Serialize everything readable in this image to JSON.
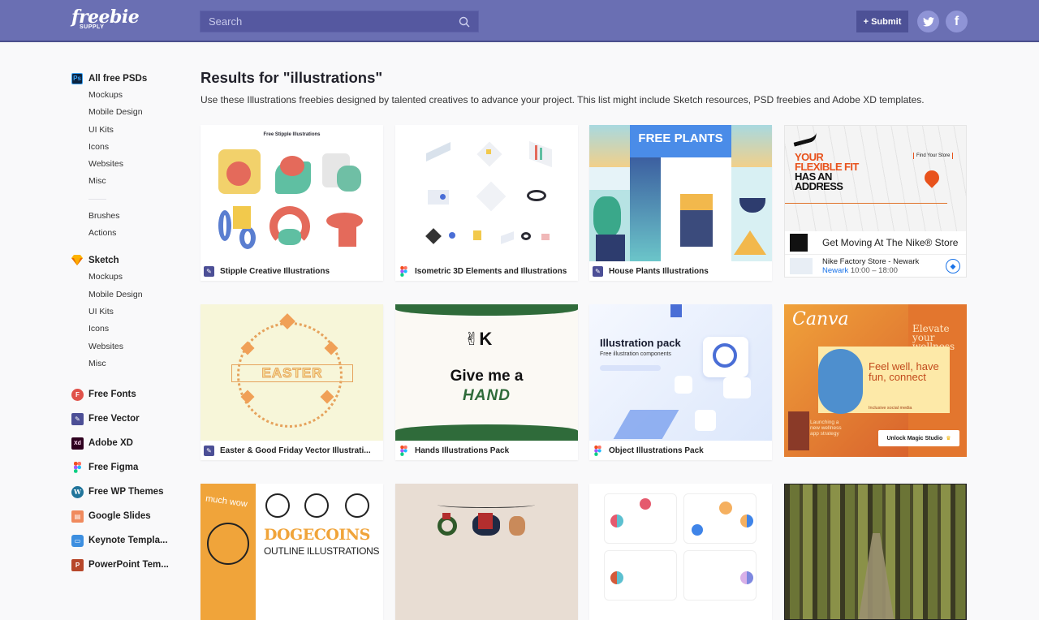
{
  "header": {
    "logo_line1": "freebie",
    "logo_line2": "SUPPLY",
    "search_placeholder": "Search",
    "submit_label": "+ Submit",
    "social": [
      {
        "name": "twitter",
        "glyph": "🐦"
      },
      {
        "name": "facebook",
        "glyph": "f"
      }
    ]
  },
  "sidebar": {
    "psd": {
      "label": "All free PSDs",
      "icon_text": "Ps",
      "items": [
        "Mockups",
        "Mobile Design",
        "UI Kits",
        "Icons",
        "Websites",
        "Misc"
      ],
      "extra": [
        "Brushes",
        "Actions"
      ]
    },
    "sketch": {
      "label": "Sketch",
      "items": [
        "Mockups",
        "Mobile Design",
        "UI Kits",
        "Icons",
        "Websites",
        "Misc"
      ]
    },
    "categories": [
      {
        "label": "Free Fonts",
        "icon": "font-icon",
        "glyph": "F",
        "color": "#e0524a"
      },
      {
        "label": "Free Vector",
        "icon": "pen-icon",
        "glyph": "✎",
        "color": "#4c4f96"
      },
      {
        "label": "Adobe XD",
        "icon": "xd-icon",
        "glyph": "Xd",
        "color": "#2e001f"
      },
      {
        "label": "Free Figma",
        "icon": "figma-icon",
        "glyph": "",
        "color": "#f24e1e"
      },
      {
        "label": "Free WP Themes",
        "icon": "wordpress-icon",
        "glyph": "W",
        "color": "#21759b"
      },
      {
        "label": "Google Slides",
        "icon": "slides-icon",
        "glyph": "▤",
        "color": "#f08a5d"
      },
      {
        "label": "Keynote Templa...",
        "icon": "keynote-icon",
        "glyph": "▭",
        "color": "#3d8fe0"
      },
      {
        "label": "PowerPoint Tem...",
        "icon": "powerpoint-icon",
        "glyph": "P",
        "color": "#b7472a"
      }
    ]
  },
  "main": {
    "title": "Results for \"illustrations\"",
    "description": "Use these Illustrations freebies designed by talented creatives to advance your project. This list might include Sketch resources, PSD freebies and Adobe XD templates.",
    "cards": [
      {
        "title": "Stipple Creative Illustrations",
        "type": "vector",
        "thumb_text": "Free Stipple Illustrations"
      },
      {
        "title": "Isometric 3D Elements and Illustrations",
        "type": "figma",
        "thumb_text": ""
      },
      {
        "title": "House Plants Illustrations",
        "type": "vector",
        "thumb_text": "FREE PLANTS"
      },
      {
        "title": "Easter & Good Friday Vector Illustrati...",
        "type": "vector",
        "thumb_text": "EASTER"
      },
      {
        "title": "Hands Illustrations Pack",
        "type": "figma",
        "thumb_text": "Give me a",
        "thumb_text2": "HAND"
      },
      {
        "title": "Object Illustrations Pack",
        "type": "figma",
        "thumb_text": "Illustration pack",
        "thumb_text2": "Free illustration components"
      },
      {
        "title": "",
        "type": "none",
        "thumb_text": "much wow",
        "thumb_text2": "DOGECOINS",
        "thumb_text3": "OUTLINE ILLUSTRATIONS"
      },
      {
        "title": "",
        "type": "none",
        "thumb_text": ""
      },
      {
        "title": "",
        "type": "none",
        "thumb_text": ""
      }
    ],
    "ads": [
      {
        "headline1": "YOUR",
        "headline2": "FLEXIBLE FIT",
        "headline3": "HAS AN",
        "headline4": "ADDRESS",
        "find_store": "Find Your Store",
        "tagline": "Get Moving At The Nike® Store",
        "store_name": "Nike Factory Store - Newark",
        "store_city": "Newark",
        "store_hours": "10:00 – 18:00"
      },
      {
        "brand": "Canva",
        "headline": "Feel well, have fun, connect",
        "sub": "Inclusive social media",
        "side_text": "Elevate your wellness",
        "launch_text": "Launching a new wellness app strategy",
        "cta": "Unlock Magic Studio"
      }
    ]
  }
}
